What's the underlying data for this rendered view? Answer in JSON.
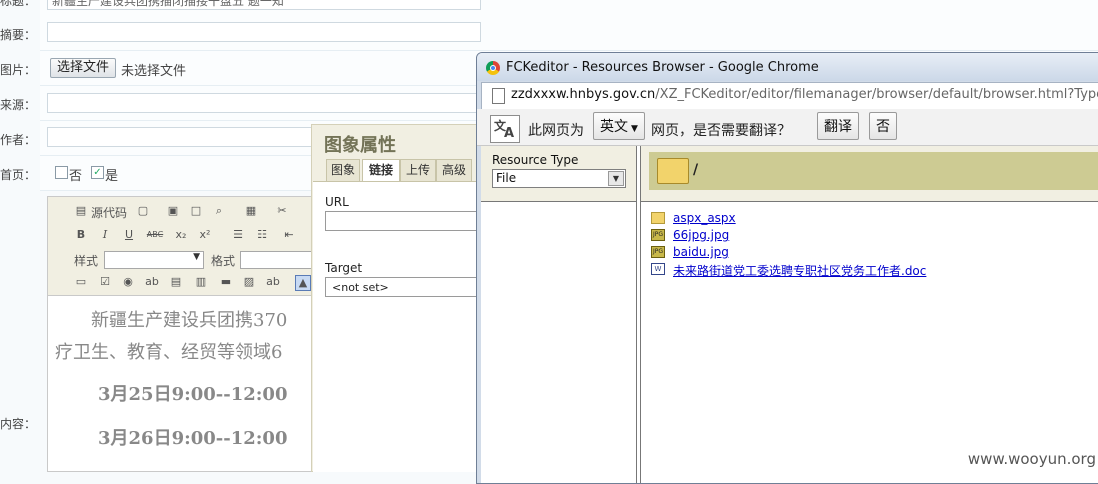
{
  "form": {
    "labels": {
      "title": "标题：",
      "summary": "摘要：",
      "image": "图片：",
      "source": "来源：",
      "author": "作者：",
      "homepage": "首页：",
      "content": "内容："
    },
    "title_value": "新疆生产建设兵团携描闭描接干盘五 题一知",
    "file_button": "选择文件",
    "file_status": "未选择文件",
    "homepage_no": "否",
    "homepage_yes": "是",
    "homepage_yes_checked": true
  },
  "editor": {
    "toolbar": {
      "source_label": "源代码",
      "style_label": "样式",
      "format_label": "格式",
      "bold": "B",
      "italic": "I",
      "underline": "U",
      "strike": "ABC"
    },
    "content_lines": [
      "新疆生产建设兵团携370",
      "疗卫生、教育、经贸等领域6",
      "3月25日9:00--12:00",
      "3月26日9:00--12:00"
    ]
  },
  "image_dialog": {
    "title": "图象属性",
    "tabs": [
      "图象",
      "链接",
      "上传",
      "高级"
    ],
    "active_tab": "链接",
    "url_label": "URL",
    "url_value": "",
    "target_label": "Target",
    "target_value": "<not set>"
  },
  "chrome_window": {
    "title": "FCKeditor - Resources Browser - Google Chrome",
    "url_domain": "zzdxxxw.hnbys.gov.cn",
    "url_path": "/XZ_FCKeditor/editor/filemanager/browser/default/browser.html?Type=File&Co",
    "translate": {
      "prefix": "此网页为",
      "language": "英文",
      "suffix": "网页，是否需要翻译？",
      "translate_button": "翻译",
      "no_button": "否"
    }
  },
  "resource_browser": {
    "resource_type_label": "Resource Type",
    "resource_type_value": "File",
    "current_path": "/",
    "files": [
      {
        "name": "aspx_aspx",
        "kind": "folder"
      },
      {
        "name": "66jpg.jpg",
        "kind": "jpg"
      },
      {
        "name": "baidu.jpg",
        "kind": "jpg"
      },
      {
        "name": "未来路街道党工委选聘专职社区党务工作者.doc",
        "kind": "doc"
      }
    ]
  },
  "watermark": "www.wooyun.org"
}
